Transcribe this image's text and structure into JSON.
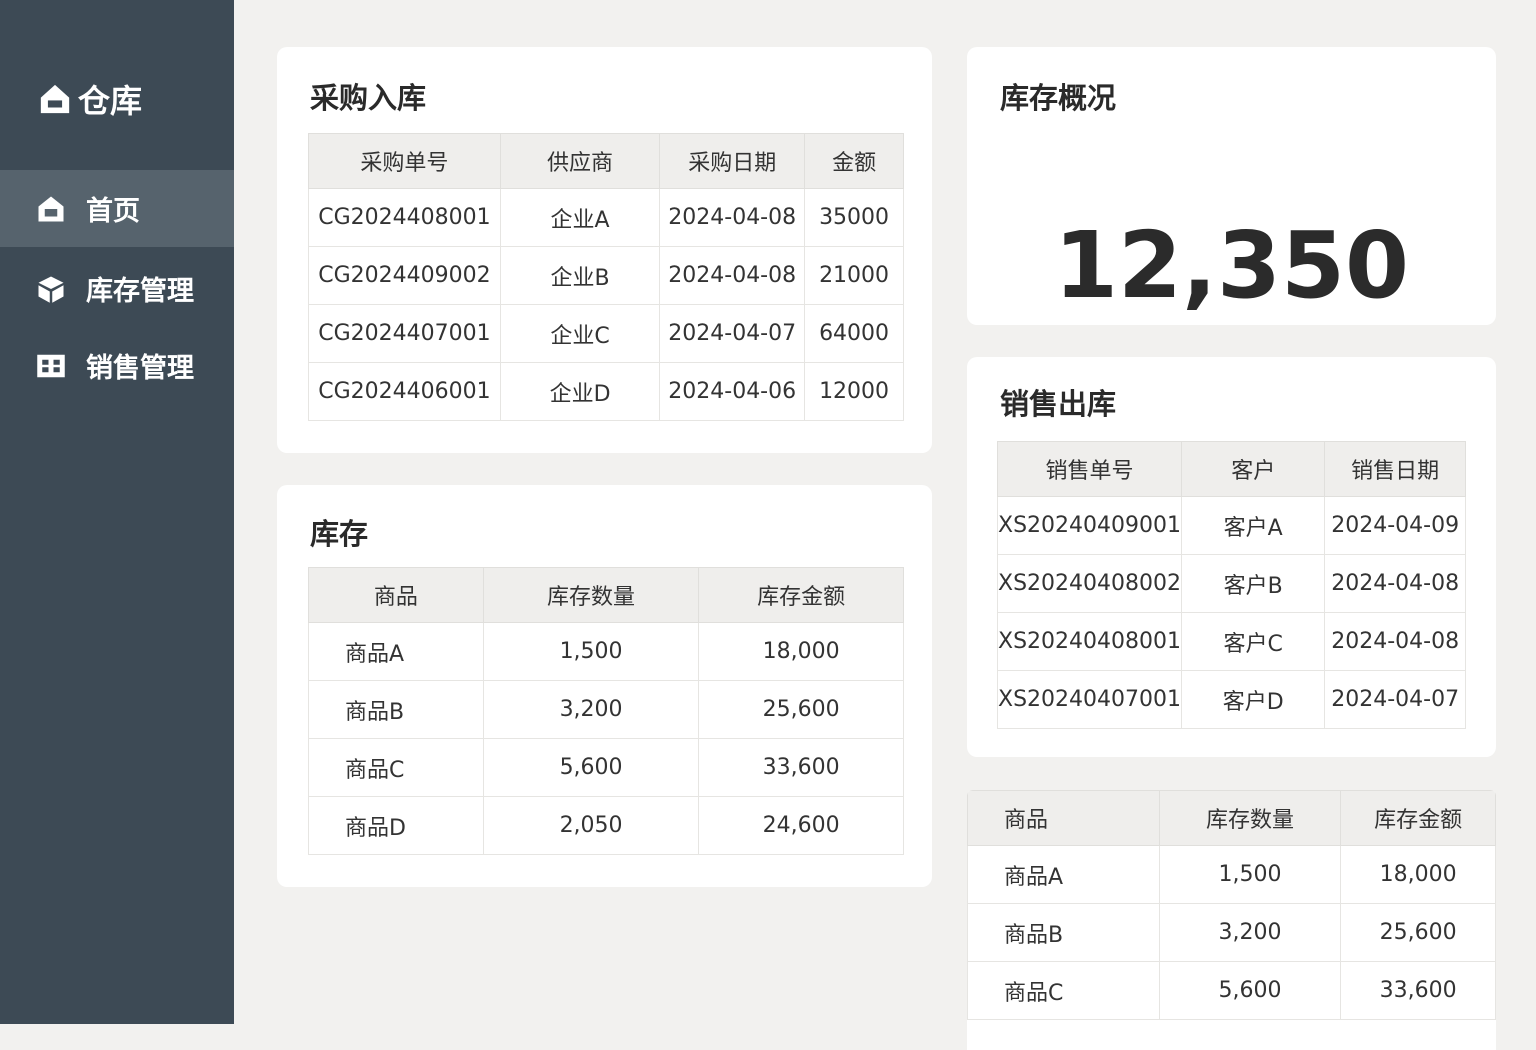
{
  "sidebar": {
    "logo": "仓库",
    "items": [
      {
        "label": "首页"
      },
      {
        "label": "库存管理"
      },
      {
        "label": "销售管理"
      }
    ]
  },
  "purchase": {
    "title": "采购入库",
    "headers": [
      "采购单号",
      "供应商",
      "采购日期",
      "金额"
    ],
    "rows": [
      [
        "CG2024408001",
        "企业A",
        "2024-04-08",
        "35000"
      ],
      [
        "CG2024409002",
        "企业B",
        "2024-04-08",
        "21000"
      ],
      [
        "CG2024407001",
        "企业C",
        "2024-04-07",
        "64000"
      ],
      [
        "CG2024406001",
        "企业D",
        "2024-04-06",
        "12000"
      ]
    ]
  },
  "inventory": {
    "title": "库存",
    "headers": [
      "商品",
      "库存数量",
      "库存金额"
    ],
    "rows": [
      [
        "商品A",
        "1,500",
        "18,000"
      ],
      [
        "商品B",
        "3,200",
        "25,600"
      ],
      [
        "商品C",
        "5,600",
        "33,600"
      ],
      [
        "商品D",
        "2,050",
        "24,600"
      ]
    ]
  },
  "overview": {
    "title": "库存概况",
    "value": "12,350"
  },
  "sales": {
    "title": "销售出库",
    "headers": [
      "销售单号",
      "客户",
      "销售日期"
    ],
    "rows": [
      [
        "XS20240409001",
        "客户A",
        "2024-04-09"
      ],
      [
        "XS20240408002",
        "客户B",
        "2024-04-08"
      ],
      [
        "XS20240408001",
        "客户C",
        "2024-04-08"
      ],
      [
        "XS20240407001",
        "客户D",
        "2024-04-07"
      ]
    ]
  },
  "inventory2": {
    "headers": [
      "商品",
      "库存数量",
      "库存金额"
    ],
    "rows": [
      [
        "商品A",
        "1,500",
        "18,000"
      ],
      [
        "商品B",
        "3,200",
        "25,600"
      ],
      [
        "商品C",
        "5,600",
        "33,600"
      ]
    ]
  }
}
